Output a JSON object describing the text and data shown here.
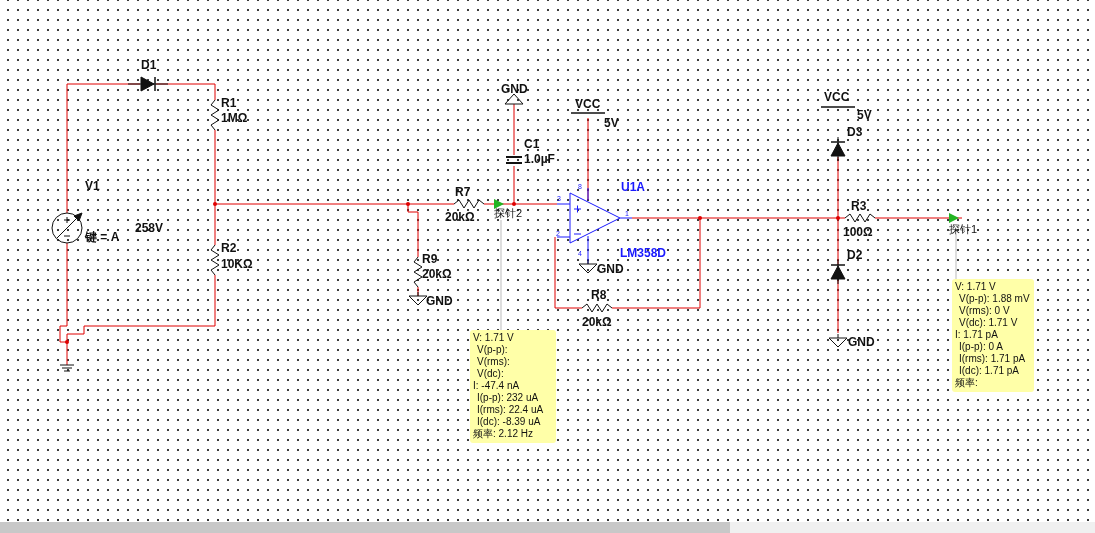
{
  "components": [
    {
      "kind": "source",
      "ref": "V1",
      "value": "258V",
      "key": "键 = A"
    },
    {
      "kind": "diode",
      "ref": "D1"
    },
    {
      "kind": "resistor",
      "ref": "R1",
      "value": "1MΩ"
    },
    {
      "kind": "resistor",
      "ref": "R2",
      "value": "10KΩ"
    },
    {
      "kind": "resistor",
      "ref": "R9",
      "value": "20kΩ"
    },
    {
      "kind": "resistor",
      "ref": "R7",
      "value": "20kΩ"
    },
    {
      "kind": "capacitor",
      "ref": "C1",
      "value": "1.0µF"
    },
    {
      "kind": "opamp",
      "ref": "U1A",
      "value": "LM358D",
      "pins": [
        "3",
        "2",
        "1",
        "8",
        "4"
      ]
    },
    {
      "kind": "resistor",
      "ref": "R8",
      "value": "20kΩ"
    },
    {
      "kind": "diode",
      "ref": "D3"
    },
    {
      "kind": "resistor",
      "ref": "R3",
      "value": "100Ω"
    },
    {
      "kind": "diode",
      "ref": "D2"
    }
  ],
  "supplies": [
    {
      "kind": "ground",
      "label": "GND"
    },
    {
      "kind": "vcc",
      "label": "VCC",
      "value": "5V"
    },
    {
      "kind": "ground",
      "label": "GND"
    },
    {
      "kind": "ground",
      "label": "GND"
    },
    {
      "kind": "vcc",
      "label": "VCC",
      "value": "5V"
    },
    {
      "kind": "ground",
      "label": "GND"
    },
    {
      "kind": "earth"
    }
  ],
  "probes": [
    {
      "label": "探针2",
      "readings": [
        {
          "text": "V: 1.71 V",
          "sub": false
        },
        {
          "text": "V(p-p):",
          "sub": true
        },
        {
          "text": "V(rms):",
          "sub": true
        },
        {
          "text": "V(dc):",
          "sub": true
        },
        {
          "text": "I: -47.4 nA",
          "sub": false
        },
        {
          "text": "I(p-p): 232 uA",
          "sub": true
        },
        {
          "text": "I(rms): 22.4 uA",
          "sub": true
        },
        {
          "text": "I(dc): -8.39 uA",
          "sub": true
        },
        {
          "text": "频率: 2.12 Hz",
          "sub": false
        }
      ]
    },
    {
      "label": "探针1",
      "readings": [
        {
          "text": "V: 1.71 V",
          "sub": false
        },
        {
          "text": "V(p-p): 1.88 mV",
          "sub": true
        },
        {
          "text": "V(rms): 0 V",
          "sub": true
        },
        {
          "text": "V(dc): 1.71 V",
          "sub": true
        },
        {
          "text": "I: 1.71 pA",
          "sub": false
        },
        {
          "text": "I(p-p): 0 A",
          "sub": true
        },
        {
          "text": "I(rms): 1.71 pA",
          "sub": true
        },
        {
          "text": "I(dc): 1.71 pA",
          "sub": true
        },
        {
          "text": "频率:",
          "sub": false
        }
      ]
    }
  ]
}
